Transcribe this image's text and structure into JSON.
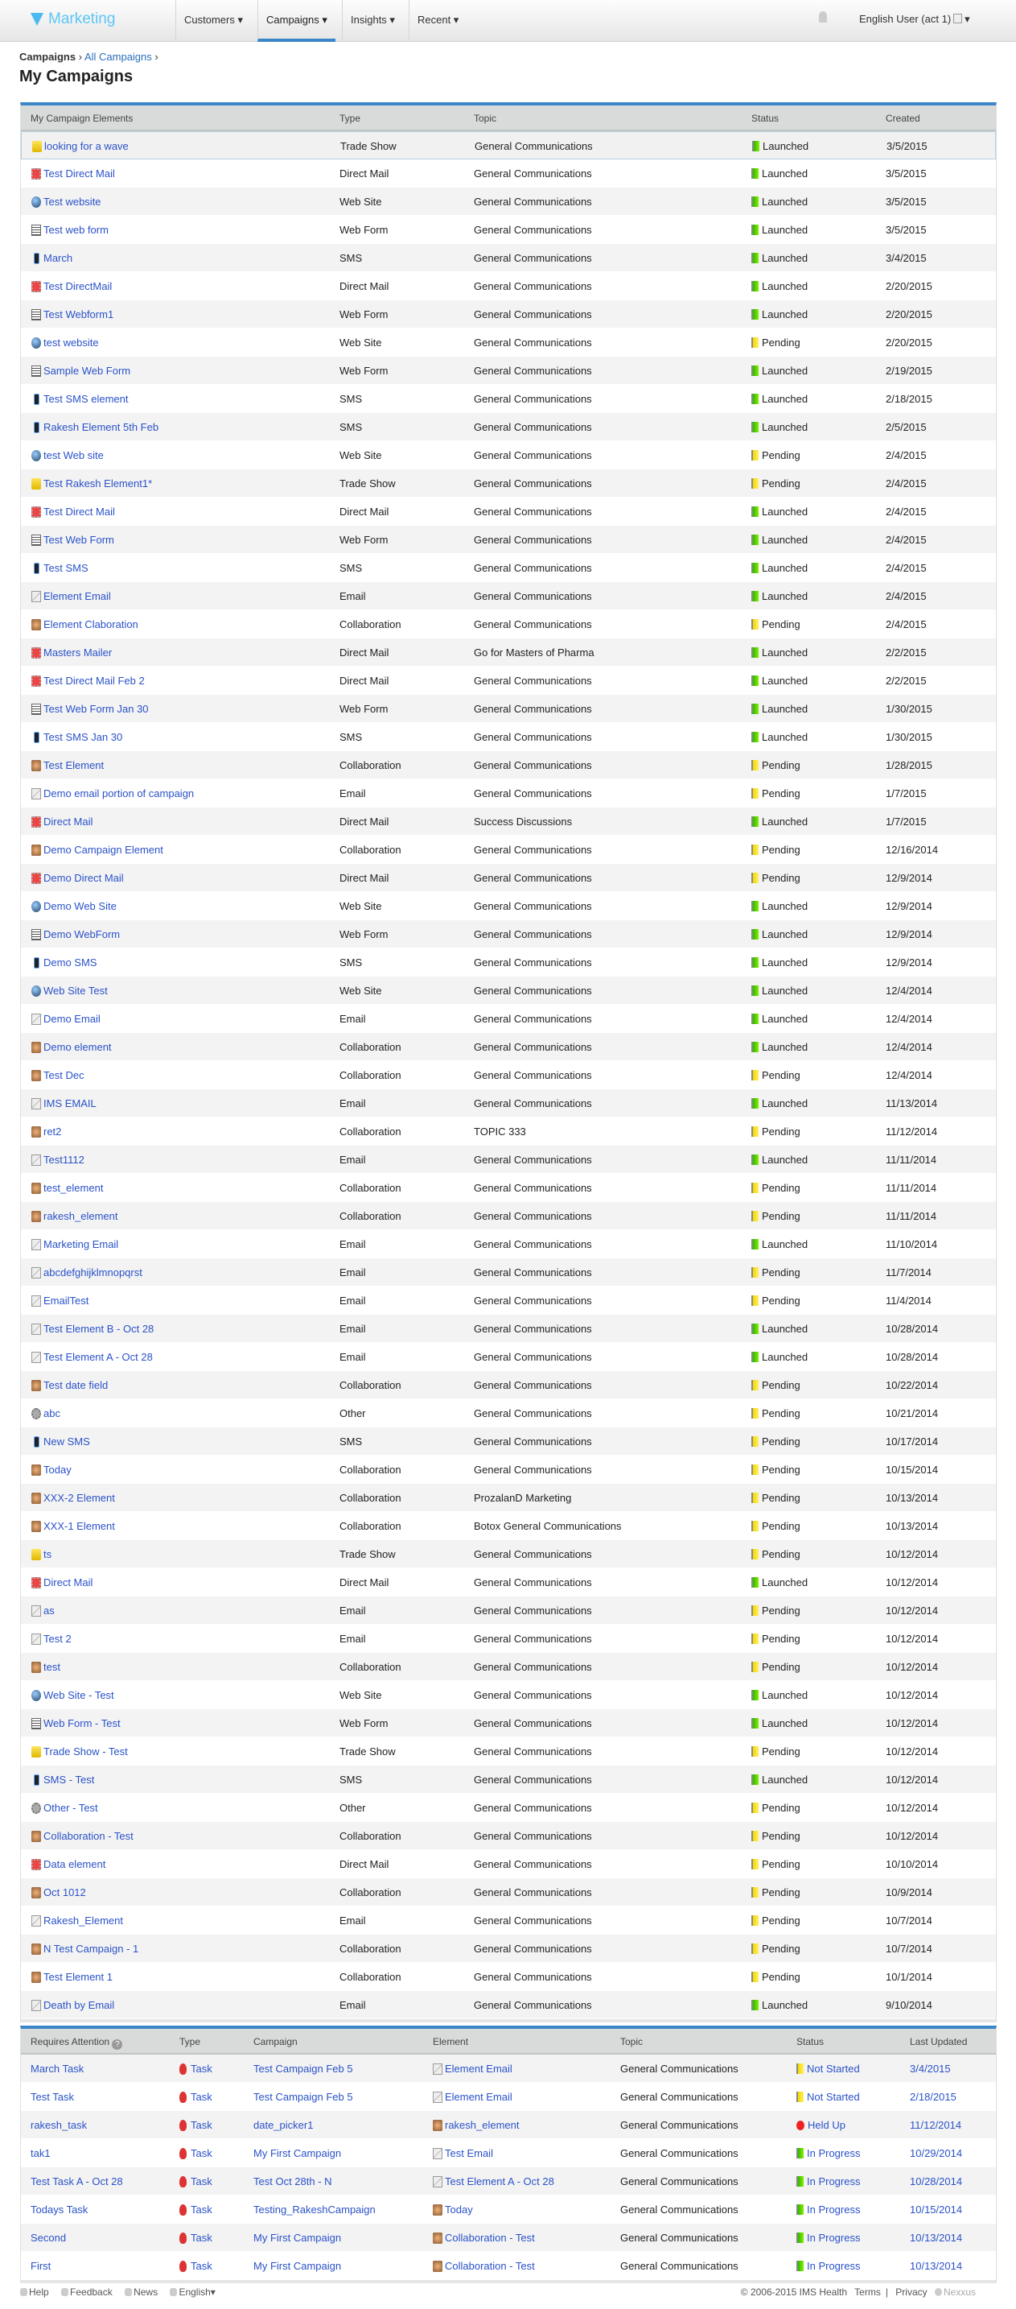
{
  "nav": {
    "logo": "Marketing",
    "items": [
      {
        "label": "Customers ▾"
      },
      {
        "label": "Campaigns ▾"
      },
      {
        "label": "Insights ▾"
      },
      {
        "label": "Recent ▾"
      }
    ],
    "active": "Campaigns",
    "user": "English User (act 1)",
    "user_caret": "▾"
  },
  "breadcrumb": {
    "root": "Campaigns",
    "sep": "›",
    "current": "All Campaigns"
  },
  "page_title": "My Campaigns",
  "elements": {
    "headers": [
      "My Campaign Elements",
      "Type",
      "Topic",
      "Status",
      "Created"
    ],
    "rows": [
      {
        "name": "looking for a wave",
        "type": "Trade Show",
        "topic": "General Communications",
        "status": "Launched",
        "created": "3/5/2015"
      },
      {
        "name": "Test Direct Mail",
        "type": "Direct Mail",
        "topic": "General Communications",
        "status": "Launched",
        "created": "3/5/2015"
      },
      {
        "name": "Test website",
        "type": "Web Site",
        "topic": "General Communications",
        "status": "Launched",
        "created": "3/5/2015"
      },
      {
        "name": "Test web form",
        "type": "Web Form",
        "topic": "General Communications",
        "status": "Launched",
        "created": "3/5/2015"
      },
      {
        "name": "March",
        "type": "SMS",
        "topic": "General Communications",
        "status": "Launched",
        "created": "3/4/2015"
      },
      {
        "name": "Test DirectMail",
        "type": "Direct Mail",
        "topic": "General Communications",
        "status": "Launched",
        "created": "2/20/2015"
      },
      {
        "name": "Test Webform1",
        "type": "Web Form",
        "topic": "General Communications",
        "status": "Launched",
        "created": "2/20/2015"
      },
      {
        "name": "test website",
        "type": "Web Site",
        "topic": "General Communications",
        "status": "Pending",
        "created": "2/20/2015"
      },
      {
        "name": "Sample Web Form",
        "type": "Web Form",
        "topic": "General Communications",
        "status": "Launched",
        "created": "2/19/2015"
      },
      {
        "name": "Test SMS element",
        "type": "SMS",
        "topic": "General Communications",
        "status": "Launched",
        "created": "2/18/2015"
      },
      {
        "name": "Rakesh Element 5th Feb",
        "type": "SMS",
        "topic": "General Communications",
        "status": "Launched",
        "created": "2/5/2015"
      },
      {
        "name": "test Web site",
        "type": "Web Site",
        "topic": "General Communications",
        "status": "Pending",
        "created": "2/4/2015"
      },
      {
        "name": "Test Rakesh Element1*",
        "type": "Trade Show",
        "topic": "General Communications",
        "status": "Pending",
        "created": "2/4/2015"
      },
      {
        "name": "Test Direct Mail",
        "type": "Direct Mail",
        "topic": "General Communications",
        "status": "Launched",
        "created": "2/4/2015"
      },
      {
        "name": "Test Web Form",
        "type": "Web Form",
        "topic": "General Communications",
        "status": "Launched",
        "created": "2/4/2015"
      },
      {
        "name": "Test SMS",
        "type": "SMS",
        "topic": "General Communications",
        "status": "Launched",
        "created": "2/4/2015"
      },
      {
        "name": "Element Email",
        "type": "Email",
        "topic": "General Communications",
        "status": "Launched",
        "created": "2/4/2015"
      },
      {
        "name": "Element Claboration",
        "type": "Collaboration",
        "topic": "General Communications",
        "status": "Pending",
        "created": "2/4/2015"
      },
      {
        "name": "Masters Mailer",
        "type": "Direct Mail",
        "topic": "Go for Masters of Pharma",
        "status": "Launched",
        "created": "2/2/2015"
      },
      {
        "name": "Test Direct Mail Feb 2",
        "type": "Direct Mail",
        "topic": "General Communications",
        "status": "Launched",
        "created": "2/2/2015"
      },
      {
        "name": "Test Web Form Jan 30",
        "type": "Web Form",
        "topic": "General Communications",
        "status": "Launched",
        "created": "1/30/2015"
      },
      {
        "name": "Test SMS Jan 30",
        "type": "SMS",
        "topic": "General Communications",
        "status": "Launched",
        "created": "1/30/2015"
      },
      {
        "name": "Test Element",
        "type": "Collaboration",
        "topic": "General Communications",
        "status": "Pending",
        "created": "1/28/2015"
      },
      {
        "name": "Demo email portion of campaign",
        "type": "Email",
        "topic": "General Communications",
        "status": "Pending",
        "created": "1/7/2015"
      },
      {
        "name": "Direct Mail",
        "type": "Direct Mail",
        "topic": "Success Discussions",
        "status": "Launched",
        "created": "1/7/2015"
      },
      {
        "name": "Demo Campaign Element",
        "type": "Collaboration",
        "topic": "General Communications",
        "status": "Pending",
        "created": "12/16/2014"
      },
      {
        "name": "Demo Direct Mail",
        "type": "Direct Mail",
        "topic": "General Communications",
        "status": "Pending",
        "created": "12/9/2014"
      },
      {
        "name": "Demo Web Site",
        "type": "Web Site",
        "topic": "General Communications",
        "status": "Launched",
        "created": "12/9/2014"
      },
      {
        "name": "Demo WebForm",
        "type": "Web Form",
        "topic": "General Communications",
        "status": "Launched",
        "created": "12/9/2014"
      },
      {
        "name": "Demo SMS",
        "type": "SMS",
        "topic": "General Communications",
        "status": "Launched",
        "created": "12/9/2014"
      },
      {
        "name": "Web Site Test",
        "type": "Web Site",
        "topic": "General Communications",
        "status": "Launched",
        "created": "12/4/2014"
      },
      {
        "name": "Demo Email",
        "type": "Email",
        "topic": "General Communications",
        "status": "Launched",
        "created": "12/4/2014"
      },
      {
        "name": "Demo element",
        "type": "Collaboration",
        "topic": "General Communications",
        "status": "Launched",
        "created": "12/4/2014"
      },
      {
        "name": "Test Dec",
        "type": "Collaboration",
        "topic": "General Communications",
        "status": "Pending",
        "created": "12/4/2014"
      },
      {
        "name": "IMS EMAIL",
        "type": "Email",
        "topic": "General Communications",
        "status": "Launched",
        "created": "11/13/2014"
      },
      {
        "name": "ret2",
        "type": "Collaboration",
        "topic": "TOPIC 333",
        "status": "Pending",
        "created": "11/12/2014"
      },
      {
        "name": "Test1112",
        "type": "Email",
        "topic": "General Communications",
        "status": "Launched",
        "created": "11/11/2014"
      },
      {
        "name": "test_element",
        "type": "Collaboration",
        "topic": "General Communications",
        "status": "Pending",
        "created": "11/11/2014"
      },
      {
        "name": "rakesh_element",
        "type": "Collaboration",
        "topic": "General Communications",
        "status": "Pending",
        "created": "11/11/2014"
      },
      {
        "name": "Marketing Email",
        "type": "Email",
        "topic": "General Communications",
        "status": "Launched",
        "created": "11/10/2014"
      },
      {
        "name": "abcdefghijklmnopqrst",
        "type": "Email",
        "topic": "General Communications",
        "status": "Pending",
        "created": "11/7/2014"
      },
      {
        "name": "EmailTest",
        "type": "Email",
        "topic": "General Communications",
        "status": "Pending",
        "created": "11/4/2014"
      },
      {
        "name": "Test Element B - Oct 28",
        "type": "Email",
        "topic": "General Communications",
        "status": "Launched",
        "created": "10/28/2014"
      },
      {
        "name": "Test Element A - Oct 28",
        "type": "Email",
        "topic": "General Communications",
        "status": "Launched",
        "created": "10/28/2014"
      },
      {
        "name": "Test date field",
        "type": "Collaboration",
        "topic": "General Communications",
        "status": "Pending",
        "created": "10/22/2014"
      },
      {
        "name": "abc",
        "type": "Other",
        "topic": "General Communications",
        "status": "Pending",
        "created": "10/21/2014"
      },
      {
        "name": "New SMS",
        "type": "SMS",
        "topic": "General Communications",
        "status": "Pending",
        "created": "10/17/2014"
      },
      {
        "name": "Today",
        "type": "Collaboration",
        "topic": "General Communications",
        "status": "Pending",
        "created": "10/15/2014"
      },
      {
        "name": "XXX-2 Element",
        "type": "Collaboration",
        "topic": "ProzalanD Marketing",
        "status": "Pending",
        "created": "10/13/2014"
      },
      {
        "name": "XXX-1 Element",
        "type": "Collaboration",
        "topic": "Botox General Communications",
        "status": "Pending",
        "created": "10/13/2014"
      },
      {
        "name": "ts",
        "type": "Trade Show",
        "topic": "General Communications",
        "status": "Pending",
        "created": "10/12/2014"
      },
      {
        "name": "Direct Mail",
        "type": "Direct Mail",
        "topic": "General Communications",
        "status": "Launched",
        "created": "10/12/2014"
      },
      {
        "name": "as",
        "type": "Email",
        "topic": "General Communications",
        "status": "Pending",
        "created": "10/12/2014"
      },
      {
        "name": "Test 2",
        "type": "Email",
        "topic": "General Communications",
        "status": "Pending",
        "created": "10/12/2014"
      },
      {
        "name": "test",
        "type": "Collaboration",
        "topic": "General Communications",
        "status": "Pending",
        "created": "10/12/2014"
      },
      {
        "name": "Web Site - Test",
        "type": "Web Site",
        "topic": "General Communications",
        "status": "Launched",
        "created": "10/12/2014"
      },
      {
        "name": "Web Form - Test",
        "type": "Web Form",
        "topic": "General Communications",
        "status": "Launched",
        "created": "10/12/2014"
      },
      {
        "name": "Trade Show - Test",
        "type": "Trade Show",
        "topic": "General Communications",
        "status": "Pending",
        "created": "10/12/2014"
      },
      {
        "name": "SMS - Test",
        "type": "SMS",
        "topic": "General Communications",
        "status": "Launched",
        "created": "10/12/2014"
      },
      {
        "name": "Other - Test",
        "type": "Other",
        "topic": "General Communications",
        "status": "Pending",
        "created": "10/12/2014"
      },
      {
        "name": "Collaboration - Test",
        "type": "Collaboration",
        "topic": "General Communications",
        "status": "Pending",
        "created": "10/12/2014"
      },
      {
        "name": "Data element",
        "type": "Direct Mail",
        "topic": "General Communications",
        "status": "Pending",
        "created": "10/10/2014"
      },
      {
        "name": "Oct 1012",
        "type": "Collaboration",
        "topic": "General Communications",
        "status": "Pending",
        "created": "10/9/2014"
      },
      {
        "name": "Rakesh_Element",
        "type": "Email",
        "topic": "General Communications",
        "status": "Pending",
        "created": "10/7/2014"
      },
      {
        "name": "N Test Campaign - 1",
        "type": "Collaboration",
        "topic": "General Communications",
        "status": "Pending",
        "created": "10/7/2014"
      },
      {
        "name": "Test Element 1",
        "type": "Collaboration",
        "topic": "General Communications",
        "status": "Pending",
        "created": "10/1/2014"
      },
      {
        "name": "Death by Email",
        "type": "Email",
        "topic": "General Communications",
        "status": "Launched",
        "created": "9/10/2014"
      }
    ]
  },
  "attention": {
    "headers": [
      "Requires Attention",
      "Type",
      "Campaign",
      "Element",
      "Topic",
      "Status",
      "Last Updated"
    ],
    "help_icon": "?",
    "rows": [
      {
        "name": "March Task",
        "type": "Task",
        "campaign": "Test Campaign Feb 5",
        "element": "Element Email",
        "element_type": "Email",
        "topic": "General Communications",
        "status": "Not Started",
        "updated": "3/4/2015"
      },
      {
        "name": "Test Task",
        "type": "Task",
        "campaign": "Test Campaign Feb 5",
        "element": "Element Email",
        "element_type": "Email",
        "topic": "General Communications",
        "status": "Not Started",
        "updated": "2/18/2015"
      },
      {
        "name": "rakesh_task",
        "type": "Task",
        "campaign": "date_picker1",
        "element": "rakesh_element",
        "element_type": "Collaboration",
        "topic": "General Communications",
        "status": "Held Up",
        "updated": "11/12/2014"
      },
      {
        "name": "tak1",
        "type": "Task",
        "campaign": "My First Campaign",
        "element": "Test Email",
        "element_type": "Email",
        "topic": "General Communications",
        "status": "In Progress",
        "updated": "10/29/2014"
      },
      {
        "name": "Test Task A - Oct 28",
        "type": "Task",
        "campaign": "Test Oct 28th - N",
        "element": "Test Element A - Oct 28",
        "element_type": "Email",
        "topic": "General Communications",
        "status": "In Progress",
        "updated": "10/28/2014"
      },
      {
        "name": "Todays Task",
        "type": "Task",
        "campaign": "Testing_RakeshCampaign",
        "element": "Today",
        "element_type": "Collaboration",
        "topic": "General Communications",
        "status": "In Progress",
        "updated": "10/15/2014"
      },
      {
        "name": "Second",
        "type": "Task",
        "campaign": "My First Campaign",
        "element": "Collaboration - Test",
        "element_type": "Collaboration",
        "topic": "General Communications",
        "status": "In Progress",
        "updated": "10/13/2014"
      },
      {
        "name": "First",
        "type": "Task",
        "campaign": "My First Campaign",
        "element": "Collaboration - Test",
        "element_type": "Collaboration",
        "topic": "General Communications",
        "status": "In Progress",
        "updated": "10/13/2014"
      }
    ]
  },
  "footer": {
    "help": "Help",
    "feedback": "Feedback",
    "news": "News",
    "language": "English▾",
    "copyright": "© 2006-2015 IMS Health",
    "terms": "Terms",
    "sep": "|",
    "privacy": "Privacy",
    "brand": "Nexxus"
  },
  "colors": {
    "accent": "#3a86c8",
    "link": "#2a52c9",
    "launched": "#2db800",
    "pending": "#f4d800",
    "held": "#e22222"
  }
}
